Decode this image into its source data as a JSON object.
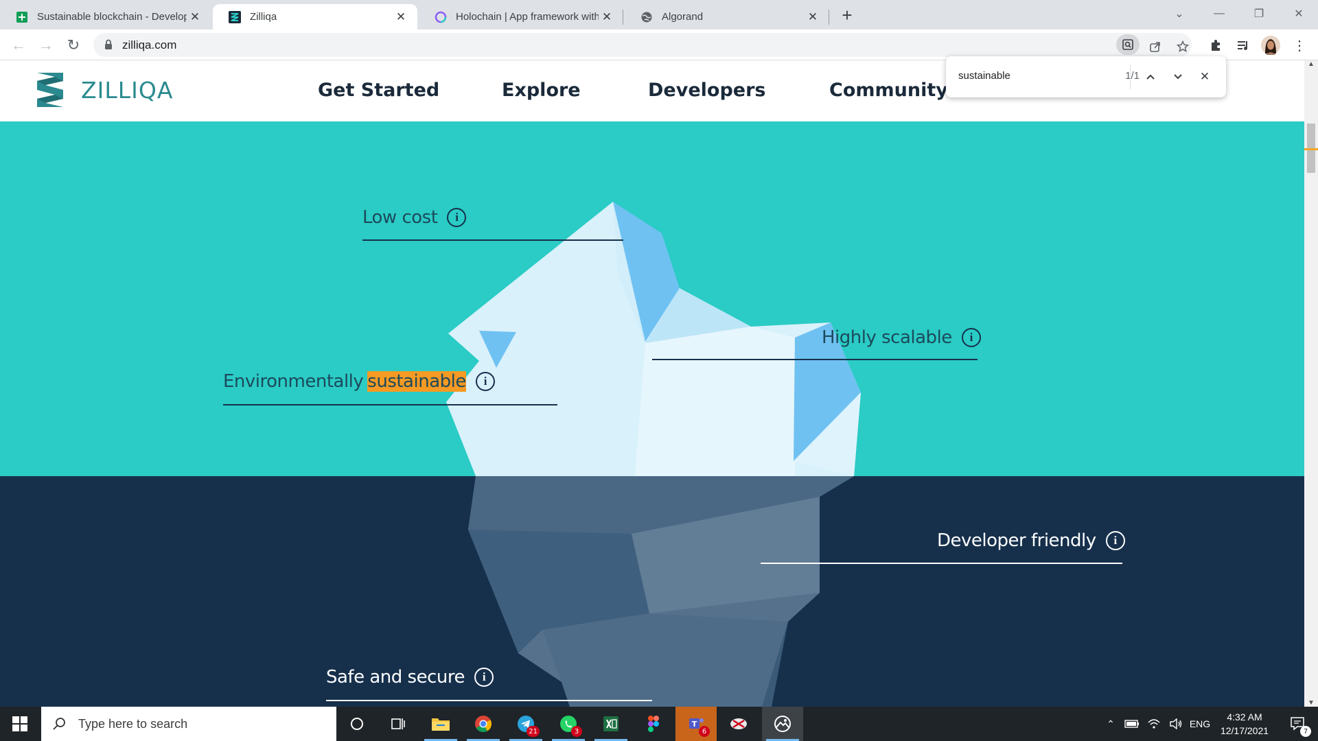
{
  "browser": {
    "tabs": [
      {
        "title": "Sustainable blockchain - Develop",
        "favicon": "sheets-icon"
      },
      {
        "title": "Zilliqa",
        "favicon": "zilliqa-icon"
      },
      {
        "title": "Holochain | App framework with",
        "favicon": "holochain-icon"
      },
      {
        "title": "Algorand",
        "favicon": "globe-icon"
      }
    ],
    "active_tab_index": 1,
    "url": "zilliqa.com"
  },
  "site": {
    "logo_text": "ZILLIQA",
    "nav": [
      "Get Started",
      "Explore",
      "Developers",
      "Community"
    ]
  },
  "features": {
    "low_cost": "Low cost",
    "env_prefix": "Environmentally",
    "env_highlight": "sustainable",
    "highly_scalable": "Highly scalable",
    "developer_friendly": "Developer friendly",
    "safe_secure": "Safe and secure",
    "info_glyph": "i"
  },
  "findbar": {
    "query": "sustainable",
    "count": "1/1"
  },
  "taskbar": {
    "search_placeholder": "Type here to search",
    "badges": {
      "telegram": "21",
      "whatsapp": "3",
      "teams": "6"
    },
    "language": "ENG",
    "time": "4:32 AM",
    "date": "12/17/2021",
    "notifications": "7"
  },
  "colors": {
    "hero_top": "#2accc5",
    "hero_bottom": "#16304c",
    "highlight": "#f59a23",
    "logo": "#2a8a8f"
  }
}
